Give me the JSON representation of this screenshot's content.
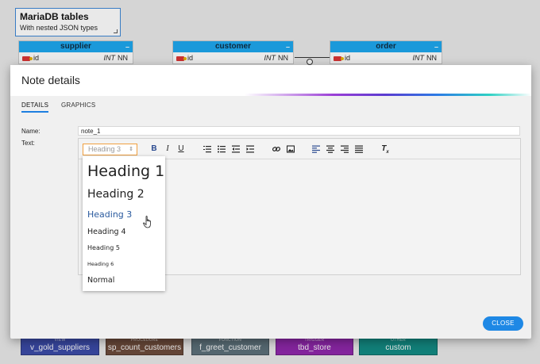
{
  "diagram": {
    "note": {
      "title": "MariaDB tables",
      "subtitle": "With nested JSON types"
    },
    "tables": [
      {
        "name": "supplier",
        "column": {
          "name": "id",
          "type": "INT",
          "nn": "NN"
        }
      },
      {
        "name": "customer",
        "column": {
          "name": "id",
          "type": "INT",
          "nn": "NN"
        }
      },
      {
        "name": "order",
        "column": {
          "name": "id",
          "type": "INT",
          "nn": "NN"
        }
      }
    ],
    "objects": [
      {
        "kind": "VIEW",
        "name": "v_gold_suppliers",
        "color": "#3848a6"
      },
      {
        "kind": "PROCEDURE",
        "name": "sp_count_customers",
        "color": "#6a4838"
      },
      {
        "kind": "FUNCTION",
        "name": "f_greet_customer",
        "color": "#5a6e78"
      },
      {
        "kind": "TRIGGER",
        "name": "tbd_store",
        "color": "#8e24aa"
      },
      {
        "kind": "OTHER",
        "name": "custom",
        "color": "#0f8a82"
      }
    ]
  },
  "modal": {
    "title": "Note details",
    "tabs": [
      "DETAILS",
      "GRAPHICS"
    ],
    "name_label": "Name:",
    "name_value": "note_1",
    "text_label": "Text:",
    "heading_select": "Heading 3",
    "heading_select_arrow": "⇕",
    "toolbar": {
      "bold": "B",
      "italic": "I",
      "underline": "U",
      "clear_format": "T"
    },
    "dropdown": [
      "Heading 1",
      "Heading 2",
      "Heading 3",
      "Heading 4",
      "Heading 5",
      "Heading 6",
      "Normal"
    ],
    "close_label": "CLOSE",
    "accent_color": "#1e88e5"
  }
}
